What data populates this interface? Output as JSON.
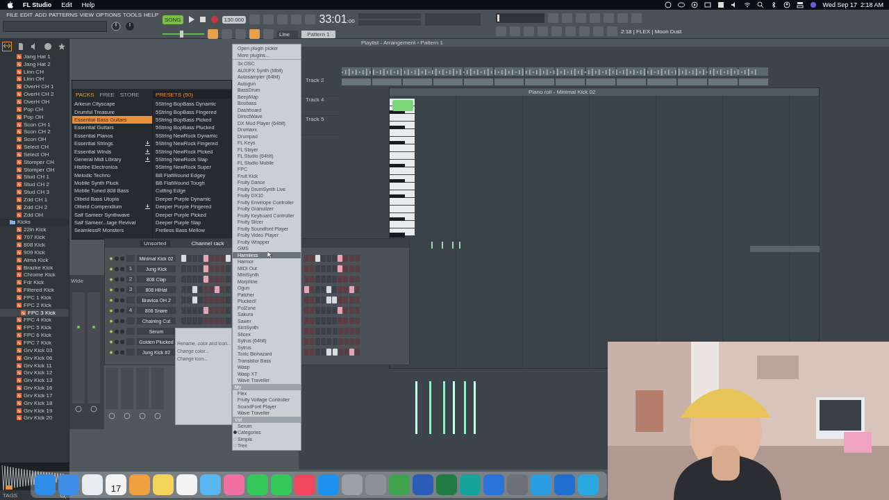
{
  "menubar": {
    "app": "FL Studio",
    "menus": [
      "Edit",
      "Help"
    ],
    "clock": "Wed Sep 17  2:18 AM"
  },
  "toolbar": {
    "menus": [
      "FILE",
      "EDIT",
      "ADD",
      "PATTERNS",
      "VIEW",
      "OPTIONS",
      "TOOLS",
      "HELP"
    ],
    "song_label": "SONG",
    "tempo": "130.000",
    "time": "33:01",
    "time_fraction": ":00",
    "master_volume": {
      "level": 0.45
    },
    "snap": "Line",
    "pattern": "Pattern 1",
    "hint": "2:18 | FLEX | Moon Dust"
  },
  "browser": {
    "items": [
      {
        "kind": "file",
        "label": "Jang Hat 1",
        "selected": false
      },
      {
        "kind": "file",
        "label": "Jang Hat 2",
        "selected": false
      },
      {
        "kind": "file",
        "label": "Linn CH",
        "selected": false
      },
      {
        "kind": "file",
        "label": "Linn OH",
        "selected": false
      },
      {
        "kind": "file",
        "label": "OverH CH 1",
        "selected": false
      },
      {
        "kind": "file",
        "label": "OverH CH 2",
        "selected": false
      },
      {
        "kind": "file",
        "label": "OverH OH",
        "selected": false
      },
      {
        "kind": "file",
        "label": "Pop CH",
        "selected": false
      },
      {
        "kind": "file",
        "label": "Pop OH",
        "selected": false
      },
      {
        "kind": "file",
        "label": "Scon CH 1",
        "selected": false
      },
      {
        "kind": "file",
        "label": "Scon CH 2",
        "selected": false
      },
      {
        "kind": "file",
        "label": "Scon OH",
        "selected": false
      },
      {
        "kind": "file",
        "label": "Select CH",
        "selected": false
      },
      {
        "kind": "file",
        "label": "Select OH",
        "selected": false
      },
      {
        "kind": "file",
        "label": "Stomper CH",
        "selected": false
      },
      {
        "kind": "file",
        "label": "Stomper OH",
        "selected": false
      },
      {
        "kind": "file",
        "label": "Stud CH 1",
        "selected": false
      },
      {
        "kind": "file",
        "label": "Stud CH 2",
        "selected": false
      },
      {
        "kind": "file",
        "label": "Stud CH 3",
        "selected": false
      },
      {
        "kind": "file",
        "label": "Zdd CH 1",
        "selected": false
      },
      {
        "kind": "file",
        "label": "Zdd CH 2",
        "selected": false
      },
      {
        "kind": "file",
        "label": "Zdd OH",
        "selected": false
      },
      {
        "kind": "folder",
        "label": "Kicks",
        "expanded": true,
        "children": [
          {
            "kind": "file",
            "label": "22in Kick",
            "selected": false
          },
          {
            "kind": "file",
            "label": "707 Kick",
            "selected": false
          },
          {
            "kind": "file",
            "label": "808 Kick",
            "selected": false
          },
          {
            "kind": "file",
            "label": "909 Kick",
            "selected": false
          },
          {
            "kind": "file",
            "label": "Alma Kick",
            "selected": false
          },
          {
            "kind": "file",
            "label": "Brazke Kick",
            "selected": false
          },
          {
            "kind": "file",
            "label": "Chrome Kick",
            "selected": false
          },
          {
            "kind": "file",
            "label": "Fdr Kick",
            "selected": false
          },
          {
            "kind": "file",
            "label": "Filtered Kick",
            "selected": false
          },
          {
            "kind": "file",
            "label": "FPC 1 Kick",
            "selected": false
          },
          {
            "kind": "file",
            "label": "FPC 2 Kick",
            "selected": false
          },
          {
            "kind": "file",
            "label": "FPC 3 Kick",
            "selected": true
          },
          {
            "kind": "file",
            "label": "FPC 4 Kick",
            "selected": false
          },
          {
            "kind": "file",
            "label": "FPC 5 Kick",
            "selected": false
          },
          {
            "kind": "file",
            "label": "FPC 6 Kick",
            "selected": false
          },
          {
            "kind": "file",
            "label": "FPC 7 Kick",
            "selected": false
          },
          {
            "kind": "file",
            "label": "Grv Kick 03",
            "selected": false
          },
          {
            "kind": "file",
            "label": "Grv Kick 06",
            "selected": false
          },
          {
            "kind": "file",
            "label": "Grv Kick 11",
            "selected": false
          },
          {
            "kind": "file",
            "label": "Grv Kick 12",
            "selected": false
          },
          {
            "kind": "file",
            "label": "Grv Kick 13",
            "selected": false
          },
          {
            "kind": "file",
            "label": "Grv Kick 16",
            "selected": false
          },
          {
            "kind": "file",
            "label": "Grv Kick 17",
            "selected": false
          },
          {
            "kind": "file",
            "label": "Grv Kick 18",
            "selected": false
          },
          {
            "kind": "file",
            "label": "Grv Kick 19",
            "selected": false
          },
          {
            "kind": "file",
            "label": "Grv Kick 20",
            "selected": false
          }
        ]
      }
    ],
    "tags_label": "TAGS"
  },
  "preset_browser": {
    "tabs": [
      {
        "label": "PACKS",
        "selected": true
      },
      {
        "label": "FREE",
        "selected": false
      },
      {
        "label": "STORE",
        "selected": false
      }
    ],
    "presets_title": "PRESETS (50)",
    "packs": [
      {
        "label": "Arkeun Cityscape",
        "selected": false,
        "download": false
      },
      {
        "label": "Drumful Treasure",
        "selected": false,
        "download": false
      },
      {
        "label": "Essential Bass Guitars",
        "selected": true,
        "download": false
      },
      {
        "label": "Essential Guitars",
        "selected": false,
        "download": false
      },
      {
        "label": "Essential Pianos",
        "selected": false,
        "download": false
      },
      {
        "label": "Essential Strings",
        "selected": false,
        "download": true
      },
      {
        "label": "Essential Winds",
        "selected": false,
        "download": true
      },
      {
        "label": "General Midi Library",
        "selected": false,
        "download": true
      },
      {
        "label": "Histibe Electronica",
        "selected": false,
        "download": false
      },
      {
        "label": "Melodic Techno",
        "selected": false,
        "download": false
      },
      {
        "label": "Mobile Synth Pluck",
        "selected": false,
        "download": false
      },
      {
        "label": "Mobile Tuned 808 Bass",
        "selected": false,
        "download": false
      },
      {
        "label": "Olbeid Bass Utopia",
        "selected": false,
        "download": false
      },
      {
        "label": "Olbeid Compendium",
        "selected": false,
        "download": true
      },
      {
        "label": "Saif Sameer Synthwave",
        "selected": false,
        "download": false
      },
      {
        "label": "Saif Sameer...tage Revival",
        "selected": false,
        "download": false
      },
      {
        "label": "SeamlessR Monsters",
        "selected": false,
        "download": false
      }
    ],
    "presets": [
      "5String BopBass Dynamic",
      "5String BopBass Fingered",
      "5String BopBass Picked",
      "5String BopBass Plucked",
      "5String NewRock Dynamic",
      "5String NewRock Fingered",
      "5String NewRock Picked",
      "5String NewRock Slap",
      "5String NewRock Super",
      "BB FlatWound Edgey",
      "BB FlatWound Tough",
      "Cutting Edge",
      "Deeper Purple Dynamic",
      "Deeper Purple Fingered",
      "Deeper Purple Picked",
      "Deeper Purple Slap",
      "Fretless Bass Mellow"
    ]
  },
  "channel_rack": {
    "title": "Channel rack",
    "filter": "Unsorted",
    "channels": [
      {
        "name": "Minimal Kick 02",
        "steps_left": [
          true,
          false,
          false,
          false,
          true,
          false,
          false,
          false,
          true
        ],
        "steps_right": [
          false,
          false,
          true,
          false,
          false,
          false,
          true,
          false,
          false,
          false
        ]
      },
      {
        "name": "Jung Kick",
        "number": "1",
        "steps_left": [
          false,
          false,
          false,
          false,
          true,
          false,
          false,
          false,
          false
        ],
        "steps_right": [
          false,
          false,
          false,
          false,
          false,
          false,
          true,
          false,
          false,
          false
        ]
      },
      {
        "name": "808 Clap",
        "number": "2",
        "steps_left": [
          false,
          false,
          false,
          false,
          true,
          false,
          false,
          false,
          false
        ],
        "steps_right": [
          false,
          false,
          false,
          false,
          false,
          false,
          false,
          false,
          false,
          false
        ]
      },
      {
        "name": "808 HiHat",
        "number": "3",
        "steps_left": [
          false,
          false,
          true,
          false,
          false,
          false,
          true,
          false,
          false
        ],
        "steps_right": [
          true,
          false,
          false,
          false,
          true,
          false,
          false,
          false,
          true,
          false
        ]
      },
      {
        "name": "Bravica OH 2",
        "steps_left": [
          false,
          false,
          true,
          false,
          false,
          false,
          false,
          false,
          false
        ],
        "steps_right": [
          false,
          false,
          false,
          false,
          true,
          true,
          false,
          false,
          false,
          false
        ]
      },
      {
        "name": "808 Snare",
        "number": "4",
        "steps_left": [
          false,
          false,
          false,
          false,
          true,
          false,
          false,
          false,
          false
        ],
        "steps_right": [
          false,
          false,
          false,
          false,
          false,
          false,
          true,
          false,
          false,
          false
        ]
      },
      {
        "name": "Chaining Cut",
        "steps_left": [
          false,
          false,
          false,
          false,
          false,
          false,
          false,
          false,
          false
        ],
        "steps_right": [
          false,
          false,
          false,
          false,
          false,
          false,
          false,
          false,
          false,
          false
        ]
      },
      {
        "name": "Serum",
        "steps_right": [
          false,
          false,
          false,
          false,
          false,
          false,
          false,
          false,
          false,
          false
        ]
      },
      {
        "name": "Golden Plucked",
        "steps_right": [
          false,
          false,
          false,
          false,
          false,
          false,
          false,
          false,
          false,
          false
        ]
      },
      {
        "name": "Jung Kick #2",
        "steps_right": [
          false,
          false,
          false,
          false,
          true,
          true,
          false,
          false,
          true,
          false
        ]
      }
    ]
  },
  "context_menu": {
    "items": [
      "Rename, color and icon...",
      "Change color...",
      "Change icon..."
    ]
  },
  "plugin_menu": {
    "items": [
      {
        "kind": "item",
        "label": "Open plugin picker",
        "selected": false
      },
      {
        "kind": "item",
        "label": "More plugins...",
        "selected": false
      },
      {
        "kind": "item",
        "label": "3x OSC",
        "selected": false
      },
      {
        "kind": "item",
        "label": "AUX/FX Synth (Mbit)",
        "selected": false
      },
      {
        "kind": "item",
        "label": "Autosampler (64bit)",
        "selected": false
      },
      {
        "kind": "item",
        "label": "Autogun",
        "selected": false
      },
      {
        "kind": "item",
        "label": "BassDrum",
        "selected": false
      },
      {
        "kind": "item",
        "label": "BeepMap",
        "selected": false
      },
      {
        "kind": "item",
        "label": "Boobass",
        "selected": false
      },
      {
        "kind": "item",
        "label": "Dashboard",
        "selected": false
      },
      {
        "kind": "item",
        "label": "DirectWave",
        "selected": false
      },
      {
        "kind": "item",
        "label": "DX Mod Player (64bit)",
        "selected": false
      },
      {
        "kind": "item",
        "label": "Drumaxx",
        "selected": false
      },
      {
        "kind": "item",
        "label": "Drumpad",
        "selected": false
      },
      {
        "kind": "item",
        "label": "FL Keys",
        "selected": false
      },
      {
        "kind": "item",
        "label": "FL Slayer",
        "selected": false
      },
      {
        "kind": "item",
        "label": "FL Studio (64bit)",
        "selected": false
      },
      {
        "kind": "item",
        "label": "FL Studio Mobile",
        "selected": false
      },
      {
        "kind": "item",
        "label": "FPC",
        "selected": false
      },
      {
        "kind": "item",
        "label": "Fruit Kick",
        "selected": false
      },
      {
        "kind": "item",
        "label": "Fruity Dance",
        "selected": false
      },
      {
        "kind": "item",
        "label": "Fruity DrumSynth Live",
        "selected": false
      },
      {
        "kind": "item",
        "label": "Fruity DX10",
        "selected": false
      },
      {
        "kind": "item",
        "label": "Fruity Envelope Controller",
        "selected": false
      },
      {
        "kind": "item",
        "label": "Fruity Granulizer",
        "selected": false
      },
      {
        "kind": "item",
        "label": "Fruity Keyboard Controller",
        "selected": false
      },
      {
        "kind": "item",
        "label": "Fruity Slicer",
        "selected": false
      },
      {
        "kind": "item",
        "label": "Fruity Soundfont Player",
        "selected": false
      },
      {
        "kind": "item",
        "label": "Fruity Video Player",
        "selected": false
      },
      {
        "kind": "item",
        "label": "Fruity Wrapper",
        "selected": false
      },
      {
        "kind": "item",
        "label": "GMS",
        "selected": false
      },
      {
        "kind": "item",
        "label": "Harmless",
        "selected": true
      },
      {
        "kind": "item",
        "label": "Harmor",
        "selected": false
      },
      {
        "kind": "item",
        "label": "MIDI Out",
        "selected": false
      },
      {
        "kind": "item",
        "label": "MiniSynth",
        "selected": false
      },
      {
        "kind": "item",
        "label": "Morphine",
        "selected": false
      },
      {
        "kind": "item",
        "label": "Ogun",
        "selected": false
      },
      {
        "kind": "item",
        "label": "Patcher",
        "selected": false
      },
      {
        "kind": "item",
        "label": "Plucked!",
        "selected": false
      },
      {
        "kind": "item",
        "label": "PoiZone",
        "selected": false
      },
      {
        "kind": "item",
        "label": "Sakura",
        "selected": false
      },
      {
        "kind": "item",
        "label": "Sawer",
        "selected": false
      },
      {
        "kind": "item",
        "label": "SimSynth",
        "selected": false
      },
      {
        "kind": "item",
        "label": "Slicex",
        "selected": false
      },
      {
        "kind": "item",
        "label": "Sytrus (64bit)",
        "selected": false
      },
      {
        "kind": "item",
        "label": "Sytrus",
        "selected": false
      },
      {
        "kind": "item",
        "label": "Toxic Biohazard",
        "selected": false
      },
      {
        "kind": "item",
        "label": "Transistor Bass",
        "selected": false
      },
      {
        "kind": "item",
        "label": "Wasp",
        "selected": false
      },
      {
        "kind": "item",
        "label": "Wasp XT",
        "selected": false
      },
      {
        "kind": "item",
        "label": "Wave Traveller",
        "selected": false
      },
      {
        "kind": "header",
        "label": "My"
      },
      {
        "kind": "item",
        "label": "Flex",
        "selected": false
      },
      {
        "kind": "item",
        "label": "Fruity Voltage Controller",
        "selected": false
      },
      {
        "kind": "item",
        "label": "SoundFont Player",
        "selected": false
      },
      {
        "kind": "item",
        "label": "Wave Traveller",
        "selected": false
      },
      {
        "kind": "header",
        "label": "Vst"
      },
      {
        "kind": "item",
        "label": "Serum",
        "selected": false
      },
      {
        "kind": "radio",
        "label": "Categories",
        "selected": true
      },
      {
        "kind": "radio",
        "label": "Simple",
        "selected": false
      },
      {
        "kind": "radio",
        "label": "Tree",
        "selected": false
      }
    ]
  },
  "playlist": {
    "title": "Playlist - Arrangement › Pattern 1",
    "tracks": [
      "Track 2",
      "Track 4",
      "Track 5"
    ]
  },
  "piano_roll": {
    "title": "Piano roll - Minimal Kick 02"
  },
  "mixer": {
    "label": "Wide"
  },
  "dock": {
    "apps": [
      {
        "color": "#2f8ce8"
      },
      {
        "color": "#3d8ee6"
      },
      {
        "color": "#e8ecef"
      },
      {
        "color": "#f4f4f4",
        "date": "17"
      },
      {
        "color": "#f0a040"
      },
      {
        "color": "#f5d25a"
      },
      {
        "color": "#f4f4f4"
      },
      {
        "color": "#58b6f0"
      },
      {
        "color": "#f070a0"
      },
      {
        "color": "#34c759"
      },
      {
        "color": "#34c759"
      },
      {
        "color": "#f0475e"
      },
      {
        "color": "#1e90f0"
      },
      {
        "color": "#9aa0a8"
      },
      {
        "color": "#8e9298"
      },
      {
        "color": "#3fa34d"
      },
      {
        "color": "#2b5cb8"
      },
      {
        "color": "#1f7a44"
      },
      {
        "color": "#16a39a"
      },
      {
        "color": "#2a73d8"
      },
      {
        "color": "#6c7078"
      },
      {
        "color": "#2a9ee0"
      },
      {
        "color": "#1e6fd0"
      },
      {
        "color": "#2aa8e0"
      }
    ]
  }
}
